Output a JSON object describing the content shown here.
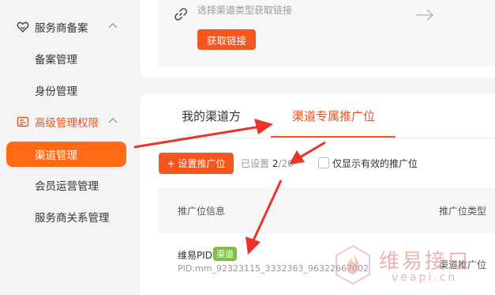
{
  "sidebar": {
    "groups": [
      {
        "label": "服务商备案",
        "icon": "heart-shield-icon"
      },
      {
        "label": "高级管理权限",
        "icon": "id-card-icon"
      }
    ],
    "items": [
      {
        "label": "备案管理"
      },
      {
        "label": "身份管理"
      },
      {
        "label": "渠道管理"
      },
      {
        "label": "会员运营管理"
      },
      {
        "label": "服务商关系管理"
      }
    ]
  },
  "top": {
    "hint": "选择渠道类型获取链接",
    "fetch_button": "获取链接"
  },
  "tabs": [
    {
      "label": "我的渠道方"
    },
    {
      "label": "渠道专属推广位"
    }
  ],
  "toolbar": {
    "set_button": "+ 设置推广位",
    "set_prefix": "已设置",
    "set_used": "2",
    "set_total": "/20",
    "checkbox_label": "仅显示有效的推广位"
  },
  "table": {
    "headers": [
      "推广位信息",
      "推广位类型"
    ],
    "rows": [
      {
        "name": "维易PID",
        "badge": "渠道",
        "pid": "PID:mm_92323115_3332363_96322667002",
        "type": "渠道推广位"
      }
    ]
  },
  "watermark": {
    "cn": "维易接口",
    "en": "veapi.cn"
  },
  "colors": {
    "accent": "#f4561e",
    "badge": "#7cc142",
    "active_text": "#e8541e"
  }
}
